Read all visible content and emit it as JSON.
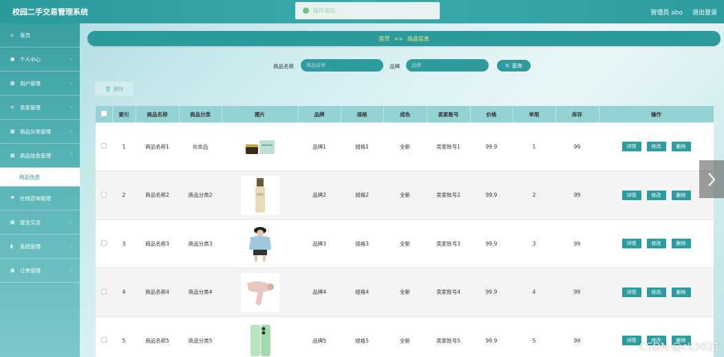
{
  "app": {
    "title": "校园二手交易管理系统"
  },
  "toast": {
    "message": "操作成功"
  },
  "header": {
    "user": "管理员 abo",
    "logout": "退出登录"
  },
  "sidebar": {
    "items": [
      {
        "label": "首页",
        "icon": "home-icon"
      },
      {
        "label": "个人中心",
        "icon": "user-icon"
      },
      {
        "label": "用户管理",
        "icon": "grid-icon"
      },
      {
        "label": "卖家管理",
        "icon": "list-icon"
      },
      {
        "label": "商品分类管理",
        "icon": "grid-icon"
      },
      {
        "label": "商品信息管理",
        "icon": "grid-icon"
      },
      {
        "label": "商品信息",
        "icon": "",
        "sub": true
      },
      {
        "label": "在线咨询管理",
        "icon": "flag-icon"
      },
      {
        "label": "留言交流",
        "icon": "grid-icon"
      },
      {
        "label": "系统管理",
        "icon": "bar-chart-icon"
      },
      {
        "label": "订单管理",
        "icon": "trash-icon"
      }
    ]
  },
  "breadcrumb": {
    "home": "首页",
    "sep": ">>",
    "current": "商品信息"
  },
  "search": {
    "name_label": "商品名称",
    "name_placeholder": "商品名称",
    "brand_label": "品牌",
    "brand_placeholder": "品牌",
    "query_label": "查询"
  },
  "toolbar": {
    "delete_label": "删除"
  },
  "table": {
    "headers": [
      "",
      "索引",
      "商品名称",
      "商品分类",
      "图片",
      "品牌",
      "规格",
      "成色",
      "卖家账号",
      "价格",
      "单限",
      "库存",
      "操作"
    ],
    "rows": [
      {
        "index": "1",
        "name": "商品名称1",
        "category": "化妆品",
        "brand": "品牌1",
        "spec": "规格1",
        "condition": "全新",
        "seller": "卖家账号1",
        "price": "99.9",
        "limit": "1",
        "stock": "99",
        "image": "cosmetics-set"
      },
      {
        "index": "2",
        "name": "商品名称2",
        "category": "商品分类2",
        "brand": "品牌2",
        "spec": "规格2",
        "condition": "全新",
        "seller": "卖家账号2",
        "price": "99.9",
        "limit": "2",
        "stock": "99",
        "image": "serum-bottle"
      },
      {
        "index": "3",
        "name": "商品名称3",
        "category": "商品分类3",
        "brand": "品牌3",
        "spec": "规格3",
        "condition": "全新",
        "seller": "卖家账号3",
        "price": "99.9",
        "limit": "3",
        "stock": "99",
        "image": "hoodie-outfit"
      },
      {
        "index": "4",
        "name": "商品名称4",
        "category": "商品分类4",
        "brand": "品牌4",
        "spec": "规格4",
        "condition": "全新",
        "seller": "卖家账号4",
        "price": "99.9",
        "limit": "4",
        "stock": "99",
        "image": "hair-dryer"
      },
      {
        "index": "5",
        "name": "商品名称5",
        "category": "商品分类5",
        "brand": "品牌5",
        "spec": "规格5",
        "condition": "全新",
        "seller": "卖家账号5",
        "price": "99.9",
        "limit": "5",
        "stock": "99",
        "image": "green-phone"
      }
    ],
    "ops": {
      "detail": "详情",
      "edit": "修改",
      "delete": "删除"
    }
  },
  "watermark": "CSDN @ck3021",
  "colors": {
    "primary": "#2e9c9e",
    "header": "#95d2d4",
    "breadcrumb_text": "#f7e97e"
  }
}
